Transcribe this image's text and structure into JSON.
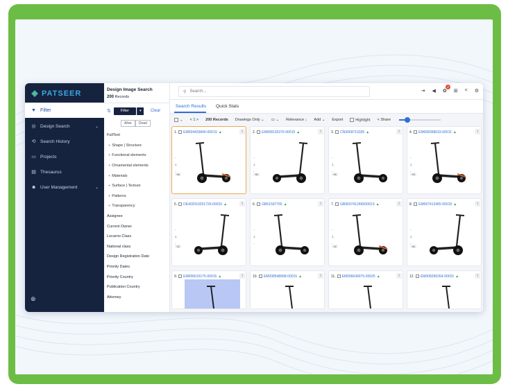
{
  "brand": {
    "name": "PATSEER",
    "accent": "#3aa8e0",
    "green_frame": "#6cbd45"
  },
  "sidebar": {
    "active": {
      "label": "Filter",
      "icon": "filter-icon"
    },
    "items": [
      {
        "label": "Design Search",
        "icon": "design-search-icon",
        "has_chevron": true
      },
      {
        "label": "Search History",
        "icon": "history-icon"
      },
      {
        "label": "Projects",
        "icon": "folder-icon"
      },
      {
        "label": "Thesaurus",
        "icon": "book-icon"
      },
      {
        "label": "User Management",
        "icon": "users-icon",
        "has_chevron": true
      }
    ],
    "footer_icon": "help-icon"
  },
  "filter_panel": {
    "title": "Design Image Search",
    "count_value": "200",
    "count_label": "Records",
    "filter_button": "Filter",
    "clear": "Clear",
    "toggle": [
      "Alive",
      "Dead"
    ],
    "fields": [
      {
        "label": "FullText",
        "sub": false
      },
      {
        "label": "Shape | Structure",
        "sub": true
      },
      {
        "label": "Functional elements",
        "sub": true
      },
      {
        "label": "Ornamental elements",
        "sub": true
      },
      {
        "label": "Materials",
        "sub": true
      },
      {
        "label": "Surface | Texture",
        "sub": true
      },
      {
        "label": "Patterns",
        "sub": true
      },
      {
        "label": "Transparency",
        "sub": true
      },
      {
        "label": "Assignee",
        "sub": false
      },
      {
        "label": "Current Owner",
        "sub": false
      },
      {
        "label": "Locarno Class",
        "sub": false
      },
      {
        "label": "National class",
        "sub": false
      },
      {
        "label": "Design Registration Date",
        "sub": false
      },
      {
        "label": "Priority Dates",
        "sub": false
      },
      {
        "label": "Priority Country",
        "sub": false
      },
      {
        "label": "Publication Country",
        "sub": false
      },
      {
        "label": "Attorney",
        "sub": false
      }
    ]
  },
  "topbar": {
    "search_placeholder": "Search...",
    "notification_count": "2"
  },
  "tabs": [
    {
      "label": "Search Results",
      "active": true
    },
    {
      "label": "Quick Stats",
      "active": false
    }
  ],
  "controls": {
    "pagination": "< 1 >",
    "records": "200 Records",
    "drawings": "Drawings Only",
    "relevance": "Relevance",
    "add": "Add",
    "export": "Export",
    "highlight": "Highlight",
    "share": "Share",
    "zoom_level": 0.2
  },
  "results": [
    {
      "num": "1.",
      "id": "EM004426840-0001S",
      "count": "+6",
      "selected": true
    },
    {
      "num": "2.",
      "id": "EM008135376-00015",
      "count": "+6"
    },
    {
      "num": "3.",
      "id": "CN3069710335",
      "count": "+5"
    },
    {
      "num": "4.",
      "id": "EM008398033-00011",
      "count": "+3"
    },
    {
      "num": "5.",
      "id": "DE402019201726-00015",
      "count": "+2"
    },
    {
      "num": "6.",
      "id": "GB61597765",
      "count": ""
    },
    {
      "num": "7.",
      "id": "GB90074124650001S",
      "count": "+2"
    },
    {
      "num": "8.",
      "id": "EM007412465-00015",
      "count": "+6"
    },
    {
      "num": "9.",
      "id": "EM006615175-00015",
      "count": ""
    },
    {
      "num": "10.",
      "id": "EM008548998-00015",
      "count": ""
    },
    {
      "num": "11.",
      "id": "EM006649075-00025",
      "count": ""
    },
    {
      "num": "12.",
      "id": "EM008390264-00015",
      "count": ""
    }
  ],
  "card_side": [
    "-",
    "1",
    "-"
  ]
}
